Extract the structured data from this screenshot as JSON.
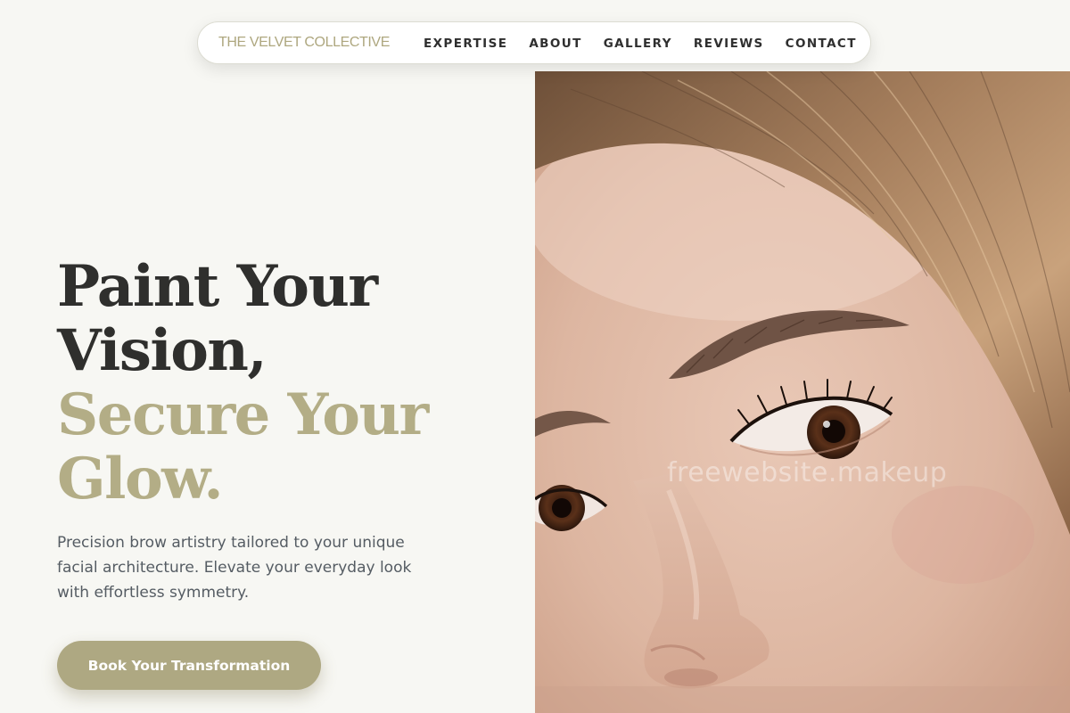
{
  "header": {
    "brand": "THE VELVET COLLECTIVE",
    "nav": [
      {
        "label": "EXPERTISE"
      },
      {
        "label": "ABOUT"
      },
      {
        "label": "GALLERY"
      },
      {
        "label": "REVIEWS"
      },
      {
        "label": "CONTACT"
      }
    ]
  },
  "hero": {
    "title_lines": [
      "Paint Your",
      "Vision,"
    ],
    "accent_lines": [
      "Secure Your",
      "Glow."
    ],
    "description": "Precision brow artistry tailored to your unique facial architecture. Elevate your everyday look with effortless symmetry.",
    "cta_label": "Book Your Transformation",
    "image_watermark": "freewebsite.makeup"
  },
  "colors": {
    "background": "#f7f7f3",
    "accent": "#aea882",
    "heading": "#2f2f2d",
    "body_text": "#555c63"
  }
}
